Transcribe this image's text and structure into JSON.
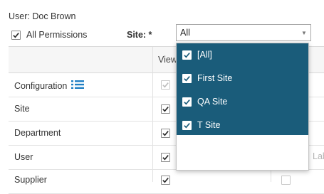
{
  "user": {
    "label": "User: Doc Brown"
  },
  "all_permissions": {
    "label": "All Permissions",
    "checked": true
  },
  "site": {
    "label": "Site: *",
    "selected": "All"
  },
  "grid": {
    "column_header": "View",
    "trailing_text": "Lab",
    "rows": [
      {
        "name": "Configuration",
        "checked": true,
        "disabled": true,
        "has_list_icon": true
      },
      {
        "name": "Site",
        "checked": true
      },
      {
        "name": "Department",
        "checked": true
      },
      {
        "name": "User",
        "checked": true
      },
      {
        "name": "Supplier",
        "checked": true
      }
    ]
  },
  "dropdown": {
    "options": [
      {
        "label": "[All]",
        "checked": true
      },
      {
        "label": "First Site",
        "checked": true
      },
      {
        "label": "QA Site",
        "checked": true
      },
      {
        "label": "T Site",
        "checked": true
      }
    ]
  },
  "colors": {
    "selection": "#1a5c7a",
    "accent_icon": "#1f7fc4",
    "check": "#2a2a2a"
  }
}
